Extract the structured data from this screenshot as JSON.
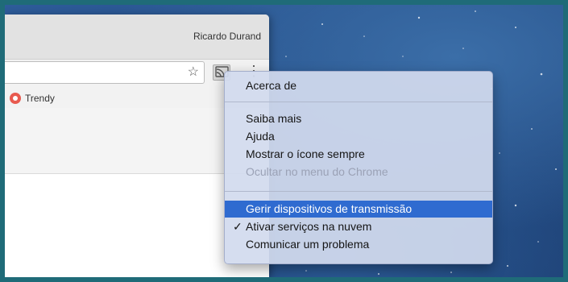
{
  "window": {
    "profile_name": "Ricardo Durand"
  },
  "bookmarks": [
    {
      "label": "Trendy",
      "icon": "trendy-icon"
    }
  ],
  "icons": {
    "star": "☆",
    "menu": "⋮",
    "check": "✓"
  },
  "menu": {
    "items": [
      {
        "label": "Acerca de",
        "state": "normal"
      },
      {
        "label": "Saiba mais",
        "state": "normal"
      },
      {
        "label": "Ajuda",
        "state": "normal"
      },
      {
        "label": "Mostrar o ícone sempre",
        "state": "normal"
      },
      {
        "label": "Ocultar no menu do Chrome",
        "state": "disabled"
      },
      {
        "label": "Gerir dispositivos de transmissão",
        "state": "highlighted"
      },
      {
        "label": "Ativar serviços na nuvem",
        "state": "checked"
      },
      {
        "label": "Comunicar um problema",
        "state": "normal"
      }
    ]
  },
  "colors": {
    "frame": "#1f6b78",
    "highlight": "#2f6bd0",
    "trendy": "#e85a4f"
  }
}
